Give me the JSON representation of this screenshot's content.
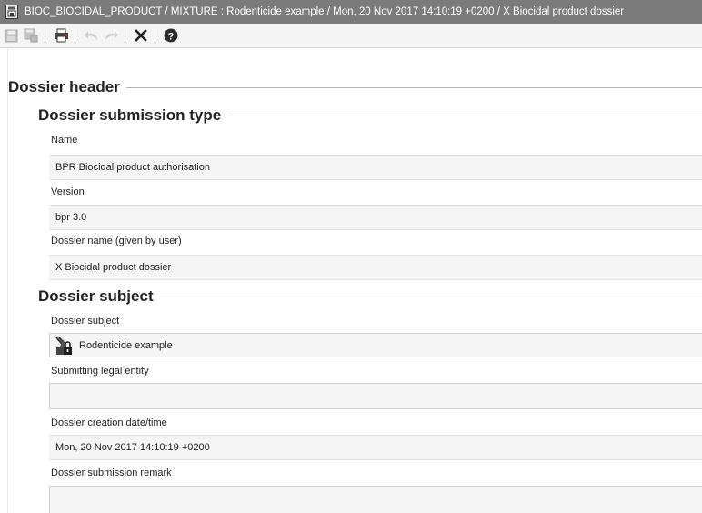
{
  "window": {
    "title": "BIOC_BIOCIDAL_PRODUCT / MIXTURE : Rodenticide example / Mon, 20 Nov 2017 14:10:19 +0200 / X Biocidal product dossier"
  },
  "toolbar": {
    "icons": [
      "save-icon",
      "save-as-icon",
      "print-icon",
      "undo-icon",
      "redo-icon",
      "close-icon",
      "help-icon"
    ]
  },
  "dossier_header": {
    "heading": "Dossier header",
    "submission_type": {
      "heading": "Dossier submission type",
      "name_label": "Name",
      "name_value": "BPR Biocidal product authorisation",
      "version_label": "Version",
      "version_value": "bpr 3.0",
      "dossier_name_label": "Dossier name (given by user)",
      "dossier_name_value": "X Biocidal product dossier"
    },
    "subject": {
      "heading": "Dossier subject",
      "subject_label": "Dossier subject",
      "subject_value": "Rodenticide example",
      "legal_entity_label": "Submitting legal entity",
      "legal_entity_value": "",
      "creation_label": "Dossier creation date/time",
      "creation_value": "Mon, 20 Nov 2017 14:10:19 +0200",
      "remark_label": "Dossier submission remark",
      "remark_value": ""
    }
  }
}
